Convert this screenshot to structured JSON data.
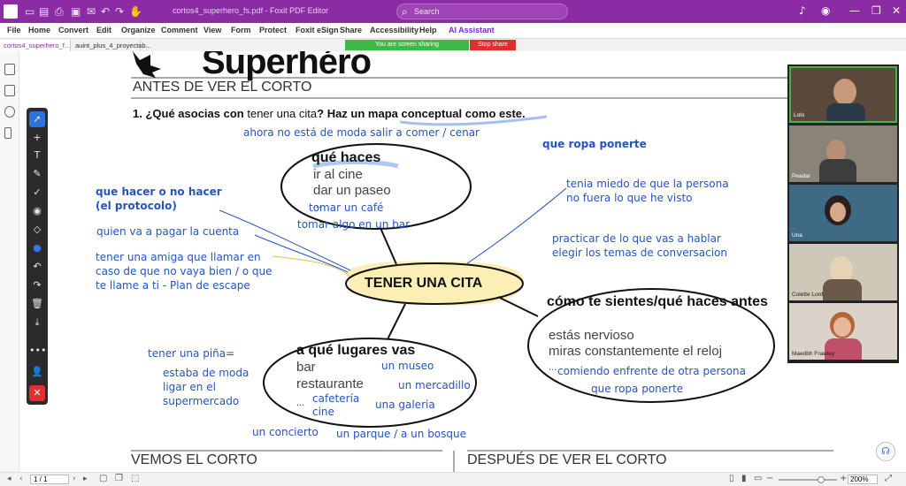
{
  "titlebar": {
    "doc_title": "cortos4_superhero_fs.pdf - Foxit PDF Editor",
    "search_placeholder": "Search"
  },
  "menu": [
    "File",
    "Home",
    "Convert",
    "Edit",
    "Organize",
    "Comment",
    "View",
    "Form",
    "Protect",
    "Foxit eSign",
    "Share",
    "Accessibility",
    "Help",
    "AI Assistant"
  ],
  "tabs": [
    "cortos4_superhero_f...",
    "auint_plus_4_proyectab..."
  ],
  "sharing": {
    "message": "You are screen sharing",
    "stop_label": "Stop share"
  },
  "document": {
    "heading_partial": "Superhéro",
    "section_before": "ANTES DE VER EL CORTO",
    "question_num": "1.",
    "question_part1": "¿Qué asocias con",
    "question_part2": "tener una cita",
    "question_part3": "? Haz un mapa conceptual como este.",
    "center_node": "TENER UNA CITA",
    "node_top": {
      "title": "qué haces",
      "items": [
        "ir al cine",
        "dar un paseo"
      ],
      "ellipsis": "..."
    },
    "node_right": {
      "title": "cómo te sientes/qué haces antes",
      "items": [
        "estás nervioso",
        "miras constantemente el reloj"
      ],
      "ellipsis": "..."
    },
    "node_bottom": {
      "title": "a qué lugares vas",
      "items": [
        "bar",
        "restaurante"
      ],
      "ellipsis": "..."
    },
    "section_watch": "VEMOS EL CORTO",
    "section_after": "DESPUÉS DE VER EL CORTO"
  },
  "annotations": {
    "a1": "ahora no está de moda salir a comer / cenar",
    "a2": "que ropa ponerte",
    "a3": "que hacer o no hacer",
    "a4": "(el protocolo)",
    "a5": "tomar un café",
    "a6": "tomar algo en un bar",
    "a7": "tenia miedo de que la persona",
    "a8": "no fuera lo que he visto",
    "a9": "quien va a pagar la cuenta",
    "a10": "practicar de lo que vas a hablar",
    "a11": "elegir los temas de conversacion",
    "a12": "tener una amiga que llamar en",
    "a13": "caso de que no vaya bien / o que",
    "a14": "te llame a ti - Plan de escape",
    "a15": "comiendo enfrente de otra persona",
    "a16": "que ropa ponerte",
    "a17": "tener una piña=",
    "a18": "estaba de moda",
    "a19": "ligar en el",
    "a20": "supermercado",
    "a21": "un museo",
    "a22": "un mercadillo",
    "a23": "cafetería",
    "a24": "cine",
    "a25": "una galeria",
    "a26": "un concierto",
    "a27": "un parque / a un bosque"
  },
  "participants": [
    "Lolo",
    "Peadar",
    "Una",
    "Colette Lord",
    "Maedbh Frawley"
  ],
  "status": {
    "page": "1 / 1",
    "zoom": "200%"
  },
  "colors": {
    "brand": "#8c2ca5",
    "ink_blue": "#2653c2",
    "highlight_yellow": "#f7e27a",
    "highlight_blue": "#8bb0f0",
    "share_green": "#3fb84a",
    "stop_red": "#e02f2f"
  }
}
